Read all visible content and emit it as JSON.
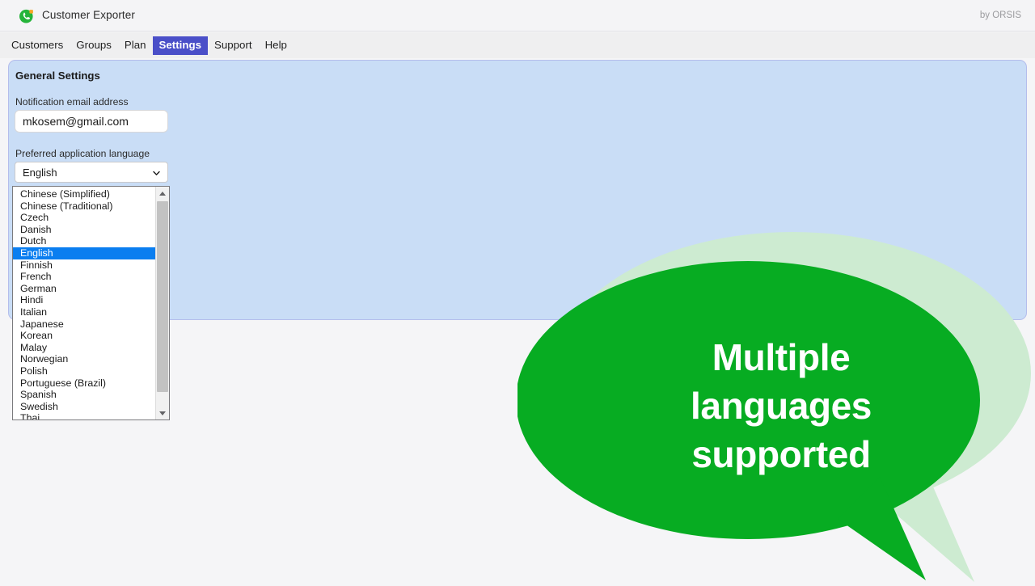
{
  "header": {
    "app_title": "Customer Exporter",
    "logo_icon": "whatsapp-green-phone-icon",
    "vendor_credit": "by ORSIS"
  },
  "nav": {
    "items": [
      {
        "label": "Customers",
        "active": false
      },
      {
        "label": "Groups",
        "active": false
      },
      {
        "label": "Plan",
        "active": false
      },
      {
        "label": "Settings",
        "active": true
      },
      {
        "label": "Support",
        "active": false
      },
      {
        "label": "Help",
        "active": false
      }
    ]
  },
  "settings_panel": {
    "heading": "General Settings",
    "email_field": {
      "label": "Notification email address",
      "value": "mkosem@gmail.com",
      "placeholder": "Notification email address"
    },
    "language_field": {
      "label": "Preferred application language",
      "selected": "English",
      "chevron_icon": "chevron-down-icon",
      "options": [
        "Chinese (Simplified)",
        "Chinese (Traditional)",
        "Czech",
        "Danish",
        "Dutch",
        "English",
        "Finnish",
        "French",
        "German",
        "Hindi",
        "Italian",
        "Japanese",
        "Korean",
        "Malay",
        "Norwegian",
        "Polish",
        "Portuguese (Brazil)",
        "Spanish",
        "Swedish",
        "Thai"
      ],
      "scrollbar": {
        "up_arrow_icon": "scroll-up-arrow-icon",
        "down_arrow_icon": "scroll-down-arrow-icon"
      }
    }
  },
  "callout": {
    "line1": "Multiple",
    "line2": "languages",
    "line3": "supported",
    "bubble_color": "#07ac22",
    "shadow_color": "#cdebd1"
  },
  "colors": {
    "header_bg": "#f4f4f6",
    "nav_bg": "#efeff0",
    "nav_active_bg": "#4a4fc8",
    "panel_bg": "#c9ddf6",
    "panel_border": "#b4bdec",
    "page_bg": "#f5f5f7",
    "select_highlight": "#0a7ef0",
    "accent_green": "#07ac22"
  }
}
